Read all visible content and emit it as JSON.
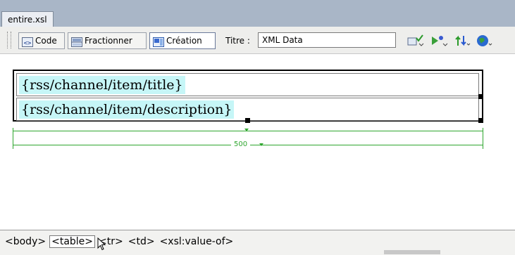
{
  "document_tab": {
    "label": "entire.xsl"
  },
  "toolbar": {
    "views": [
      {
        "label": "Code",
        "icon": "code-view-icon"
      },
      {
        "label": "Fractionner",
        "icon": "split-view-icon"
      },
      {
        "label": "Création",
        "icon": "design-view-icon"
      }
    ],
    "title_label": "Titre :",
    "title_value": "XML Data",
    "tools": [
      "validate-markup-icon",
      "preview-debug-icon",
      "file-management-icon",
      "browser-check-icon"
    ]
  },
  "design": {
    "cells": [
      "{rss/channel/item/title}",
      "{rss/channel/item/description}"
    ],
    "table_width": "500"
  },
  "tag_selector": {
    "tags": [
      "<body>",
      "<table>",
      "<tr>",
      "<td>",
      "<xsl:value-of>"
    ],
    "selected_index": 1
  }
}
